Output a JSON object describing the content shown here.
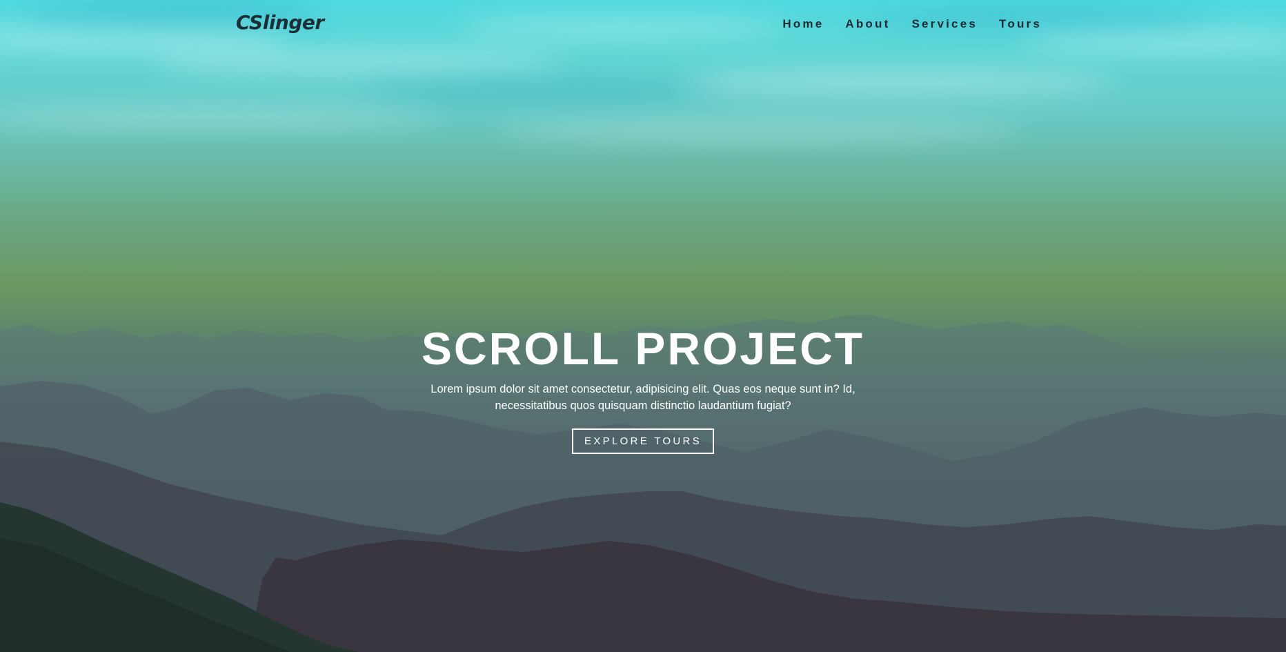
{
  "navbar": {
    "brand": "CSlinger",
    "links": [
      {
        "label": "Home"
      },
      {
        "label": "About"
      },
      {
        "label": "Services"
      },
      {
        "label": "Tours"
      }
    ]
  },
  "banner": {
    "title": "SCROLL PROJECT",
    "text": "Lorem ipsum dolor sit amet consectetur, adipisicing elit. Quas eos neque sunt in? Id, necessitatibus quos quisquam distinctio laudantium fugiat?",
    "button_label": "EXPLORE TOURS"
  },
  "colors": {
    "sky_top": "#4fd9df",
    "sky_green": "#6b9962",
    "ground_dark": "#352f38",
    "nav_text": "#1e2a30",
    "banner_text": "#ffffff"
  }
}
